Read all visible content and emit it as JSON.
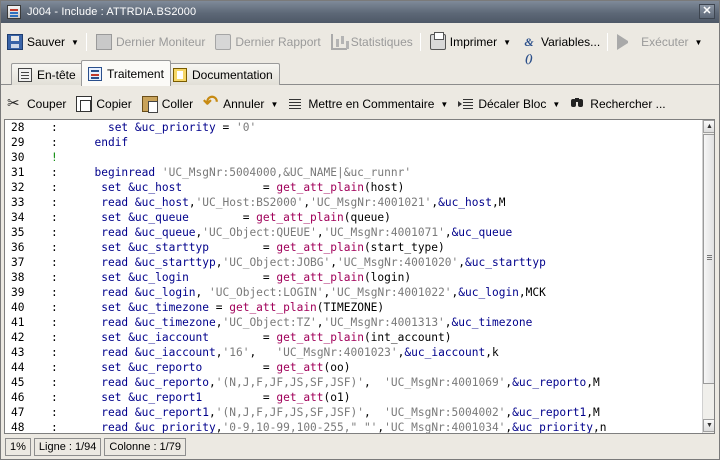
{
  "window": {
    "title": "J004 - Include : ATTRDIA.BS2000",
    "close": "✕"
  },
  "toolbar1": {
    "save": "Sauver",
    "last_monitor": "Dernier Moniteur",
    "last_report": "Dernier Rapport",
    "statistics": "Statistiques",
    "print": "Imprimer",
    "variables": "Variables...",
    "execute": "Exécuter",
    "vars_glyph": "&()"
  },
  "tabs": [
    {
      "label": "En-tête"
    },
    {
      "label": "Traitement"
    },
    {
      "label": "Documentation"
    }
  ],
  "toolbar2": {
    "cut": "Couper",
    "copy": "Copier",
    "paste": "Coller",
    "undo": "Annuler",
    "comment": "Mettre en Commentaire",
    "indent": "Décaler Bloc",
    "search": "Rechercher ..."
  },
  "editor": {
    "lines": [
      {
        "n": "28",
        "m": ":",
        "c": "    set &uc_priority = '0'"
      },
      {
        "n": "29",
        "m": ":",
        "c": "  endif"
      },
      {
        "n": "30",
        "m": "!",
        "c": ""
      },
      {
        "n": "31",
        "m": ":",
        "c": "  beginread 'UC_MsgNr:5004000,&UC_NAME|&uc_runnr'"
      },
      {
        "n": "32",
        "m": ":",
        "c": "   set &uc_host            = get_att_plain(host)"
      },
      {
        "n": "33",
        "m": ":",
        "c": "   read &uc_host,'UC_Host:BS2000','UC_MsgNr:4001021',&uc_host,M"
      },
      {
        "n": "34",
        "m": ":",
        "c": "   set &uc_queue        = get_att_plain(queue)"
      },
      {
        "n": "35",
        "m": ":",
        "c": "   read &uc_queue,'UC_Object:QUEUE','UC_MsgNr:4001071',&uc_queue"
      },
      {
        "n": "36",
        "m": ":",
        "c": "   set &uc_starttyp        = get_att_plain(start_type)"
      },
      {
        "n": "37",
        "m": ":",
        "c": "   read &uc_starttyp,'UC_Object:JOBG','UC_MsgNr:4001020',&uc_starttyp"
      },
      {
        "n": "38",
        "m": ":",
        "c": "   set &uc_login           = get_att_plain(login)"
      },
      {
        "n": "39",
        "m": ":",
        "c": "   read &uc_login, 'UC_Object:LOGIN','UC_MsgNr:4001022',&uc_login,MCK"
      },
      {
        "n": "40",
        "m": ":",
        "c": "   set &uc_timezone = get_att_plain(TIMEZONE)"
      },
      {
        "n": "41",
        "m": ":",
        "c": "   read &uc_timezone,'UC_Object:TZ','UC_MsgNr:4001313',&uc_timezone"
      },
      {
        "n": "42",
        "m": ":",
        "c": "   set &uc_iaccount        = get_att_plain(int_account)"
      },
      {
        "n": "43",
        "m": ":",
        "c": "   read &uc_iaccount,'16',   'UC_MsgNr:4001023',&uc_iaccount,k"
      },
      {
        "n": "44",
        "m": ":",
        "c": "   set &uc_reporto         = get_att(oo)"
      },
      {
        "n": "45",
        "m": ":",
        "c": "   read &uc_reporto,'(N,J,F,JF,JS,SF,JSF)',  'UC_MsgNr:4001069',&uc_reporto,M"
      },
      {
        "n": "46",
        "m": ":",
        "c": "   set &uc_report1         = get_att(o1)"
      },
      {
        "n": "47",
        "m": ":",
        "c": "   read &uc_report1,'(N,J,F,JF,JS,SF,JSF)',  'UC_MsgNr:5004002',&uc_report1,M"
      },
      {
        "n": "48",
        "m": ":",
        "c": "   read &uc_priority,'0-9,10-99,100-255,\" \"','UC_MsgNr:4001034',&uc_priority,n"
      }
    ]
  },
  "status": {
    "zoom": "1%",
    "line": "Ligne : 1/94",
    "column": "Colonne : 1/79"
  },
  "colors": {
    "keyword": "#00008b",
    "string": "#7a7a7a",
    "function": "#a0005a",
    "comment_marker": "#0a8a0a"
  }
}
